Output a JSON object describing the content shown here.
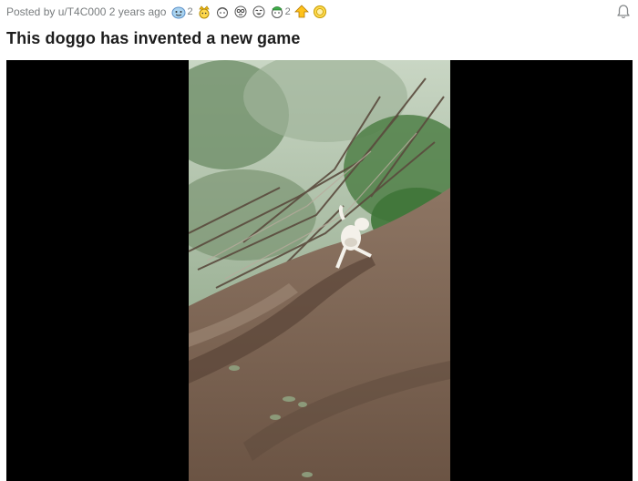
{
  "post": {
    "posted_by_prefix": "Posted by",
    "username": "u/T4C000",
    "time_ago": "2 years ago",
    "title": "This doggo has invented a new game"
  },
  "awards": [
    {
      "icon": "wholesome-award-icon",
      "count": "2"
    },
    {
      "icon": "crown-award-icon",
      "count": ""
    },
    {
      "icon": "hugz-award-icon",
      "count": ""
    },
    {
      "icon": "wearing-is-caring-award-icon",
      "count": ""
    },
    {
      "icon": "laughing-award-icon",
      "count": ""
    },
    {
      "icon": "green-award-icon",
      "count": "2"
    },
    {
      "icon": "take-my-energy-award-icon",
      "count": ""
    },
    {
      "icon": "helpful-award-icon",
      "count": ""
    }
  ],
  "colors": {
    "meta_text": "#787c7e",
    "title_text": "#1c1c1c",
    "media_background": "#000000"
  }
}
